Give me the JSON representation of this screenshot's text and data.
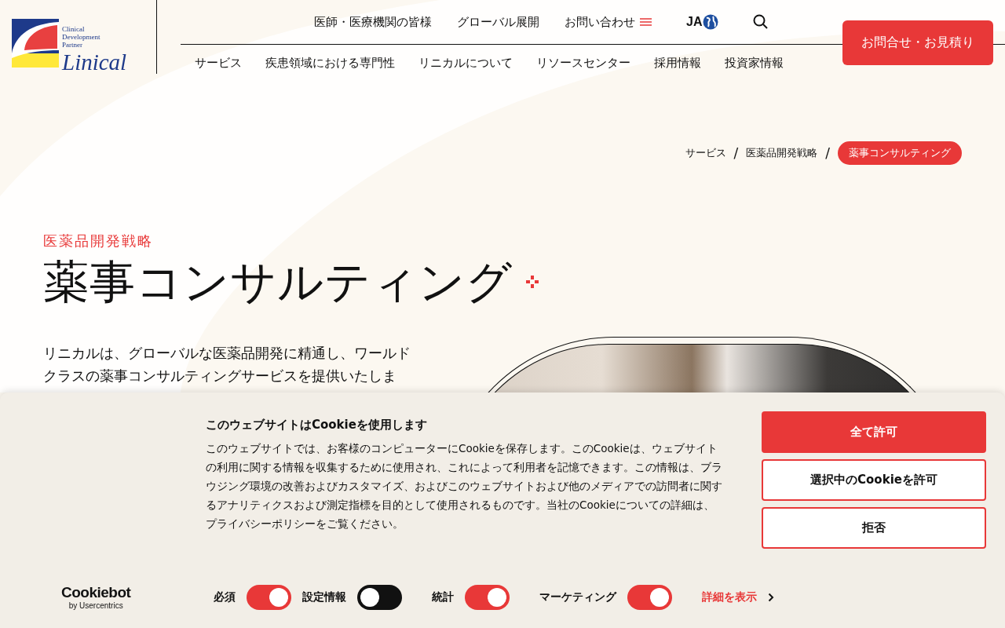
{
  "logo": {
    "tagline": [
      "Clinical",
      "Development",
      "Partner"
    ],
    "wordmark": "Linical"
  },
  "top_nav": {
    "links": [
      "医師・医療機関の皆様",
      "グローバル展開",
      "お問い合わせ"
    ],
    "language": "JA"
  },
  "contact_button": "お問合せ・お見積り",
  "main_nav": [
    "サービス",
    "疾患領域における専門性",
    "リニカルについて",
    "リソースセンター",
    "採用情報",
    "投資家情報"
  ],
  "breadcrumb": [
    {
      "label": "サービス",
      "selected": false
    },
    {
      "separator": "/",
      "label": "医薬品開発戦略",
      "selected": false
    },
    {
      "separator": "/",
      "label": "薬事コンサルティング",
      "selected": true
    }
  ],
  "page": {
    "category": "医薬品開発戦略",
    "title": "薬事コンサルティング",
    "intro": "リニカルは、グローバルな医薬品開発に精通し、ワールドクラスの薬事コンサルティングサービスを提供いたしま"
  },
  "cookie_banner": {
    "brand": "Cookiebot",
    "brand_sub": "by Usercentrics",
    "heading": "このウェブサイトはCookieを使用します",
    "body": "このウェブサイトでは、お客様のコンピューターにCookieを保存します。このCookieは、ウェブサイトの利用に関する情報を収集するために使用され、これによって利用者を記憶できます。この情報は、ブラウジング環境の改善およびカスタマイズ、およびこのウェブサイトおよび他のメディアでの訪問者に関するアナリティクスおよび測定指標を目的として使用されるものです。当社のCookieについての詳細は、プライバシーポリシーをご覧ください。",
    "buttons": [
      {
        "label": "全て許可",
        "kind": "primary"
      },
      {
        "label": "選択中のCookieを許可",
        "kind": "outline"
      },
      {
        "label": "拒否",
        "kind": "outline"
      }
    ],
    "toggles": [
      {
        "label": "必須",
        "on": true
      },
      {
        "label": "設定情報",
        "on": false
      },
      {
        "label": "統計",
        "on": true
      },
      {
        "label": "マーケティング",
        "on": true
      }
    ],
    "details_link": "詳細を表示"
  }
}
